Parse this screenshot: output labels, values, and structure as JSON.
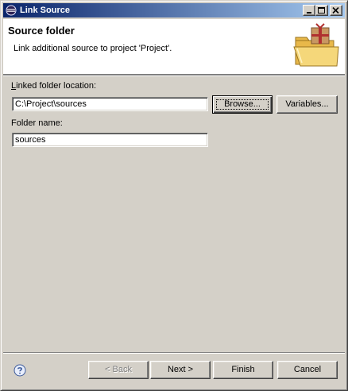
{
  "window": {
    "title": "Link Source",
    "controls": [
      "minimize-icon",
      "maximize-icon",
      "close-icon"
    ]
  },
  "banner": {
    "title": "Source folder",
    "message": "Link additional source to project 'Project'.",
    "image_icon": "folder-with-package-icon"
  },
  "form": {
    "location_label_mnemonic": "L",
    "location_label_rest": "inked folder location:",
    "location_value": "C:\\Project\\sources",
    "browse_label": "Browse...",
    "variables_label": "Variables...",
    "folder_label": "Folder name:",
    "folder_value": "sources"
  },
  "footer": {
    "help_icon": "help-icon",
    "back_label": "< Back",
    "next_label": "Next >",
    "finish_label": "Finish",
    "cancel_label": "Cancel"
  },
  "colors": {
    "titlebar_start": "#0a246a",
    "titlebar_end": "#a6caf0",
    "dialog_face": "#d4d0c8"
  }
}
